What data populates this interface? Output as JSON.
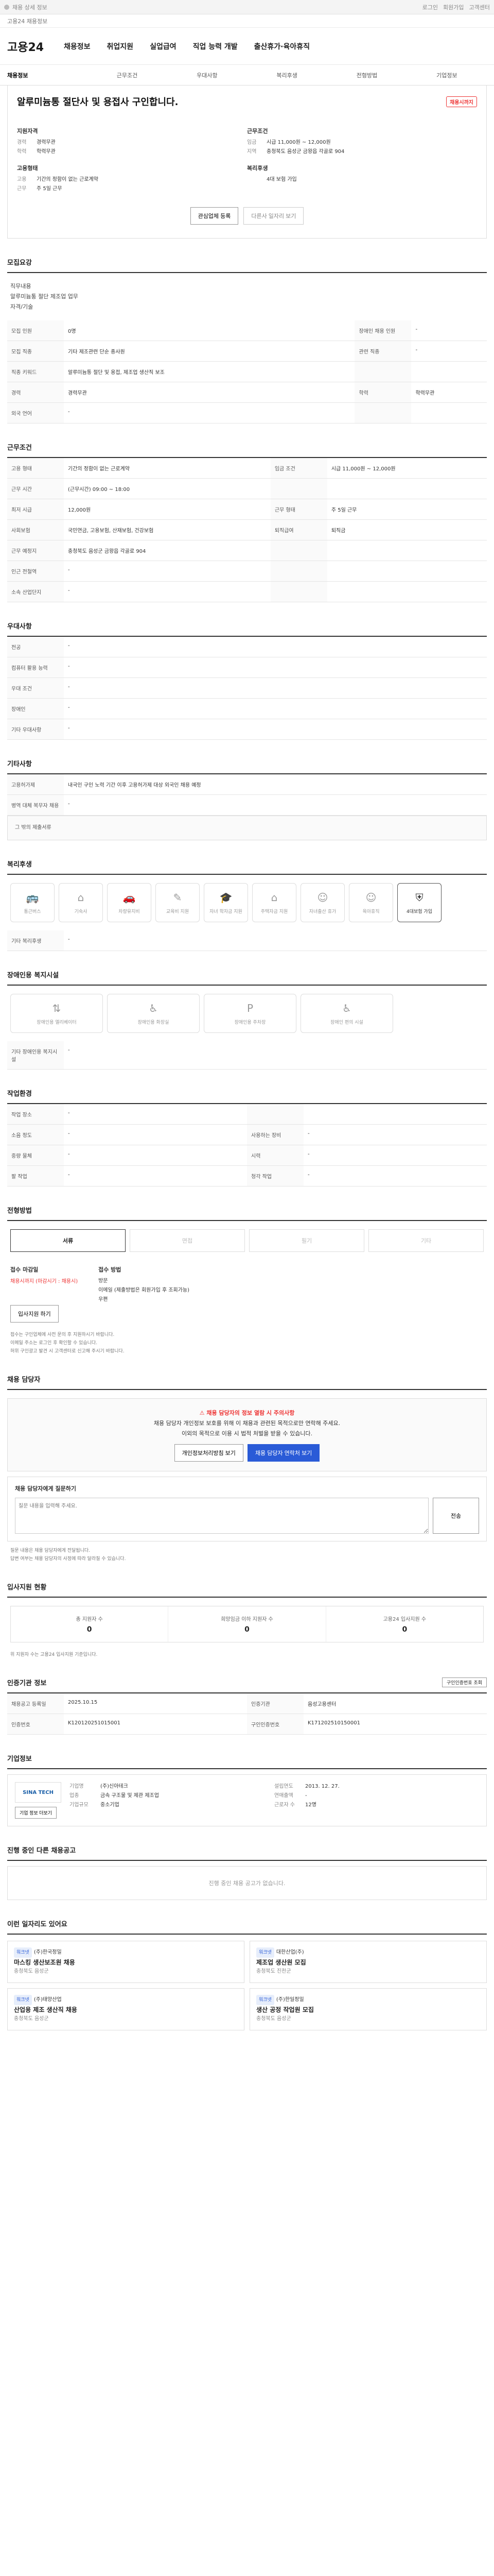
{
  "browser": {
    "bar_text": "채용 상세 정보",
    "right_items": [
      "로그인",
      "회원가입",
      "고객센터"
    ]
  },
  "infobar": {
    "text": "고용24 채용정보"
  },
  "nav": {
    "logo": "고용24",
    "menus": [
      "채용정보",
      "취업지원",
      "실업급여",
      "직업 능력 개발",
      "출산휴가·육아휴직"
    ]
  },
  "tabs": [
    "채용정보",
    "근무조건",
    "우대사항",
    "복리후생",
    "전형방법",
    "기업정보"
  ],
  "job": {
    "title": "알루미늄통 절단사 및 용접사 구인합니다.",
    "tag": "채용시까지",
    "qual_h": "지원자격",
    "qual": [
      {
        "k": "경력",
        "v": "경력무관"
      },
      {
        "k": "학력",
        "v": "학력무관"
      }
    ],
    "cond_h": "근무조건",
    "cond": [
      {
        "k": "임금",
        "v": "시급 11,000원 ~ 12,000원"
      },
      {
        "k": "지역",
        "v": "충청북도 음성군 금왕읍 각골로 904"
      }
    ],
    "emp_h": "고용형태",
    "emp": [
      {
        "k": "고용",
        "v": "기간의 정함이 없는 근로계약"
      },
      {
        "k": "근무",
        "v": "주 5일 근무"
      }
    ],
    "benefit_h": "복리후생",
    "benefit": [
      {
        "k": "",
        "v": "4대 보험 가입"
      }
    ],
    "btn_apply": "관심업체 등록",
    "btn_other": "다른사 일자리 보기"
  },
  "sections": {
    "job_content": "모집요강",
    "job_content_text": [
      "직무내용",
      "알루미늄통 절단 제조업 업무",
      "자격/기술"
    ],
    "recruit_rows": [
      {
        "k": "모집 인원",
        "v": "0명",
        "k2": "장애인 채용 인원",
        "v2": "-"
      },
      {
        "k": "모집 직종",
        "v": "기타 제조관련 단순 종사원",
        "k2": "관련 직종",
        "v2": "-"
      },
      {
        "k": "직종 키워드",
        "v": "알루미늄통 절단 및 용접, 제조업 생산직 보조",
        "k2": "",
        "v2": ""
      },
      {
        "k": "경력",
        "v": "경력무관",
        "k2": "학력",
        "v2": "학력무관"
      },
      {
        "k": "외국 언어",
        "v": "-",
        "k2": "",
        "v2": ""
      }
    ],
    "work_cond": "근무조건",
    "work_rows": [
      {
        "k": "고용 형태",
        "v": "기간의 정함이 없는 근로계약",
        "k2": "임금 조건",
        "v2": "시급 11,000원 ~ 12,000원"
      },
      {
        "k": "근무 시간",
        "v": "(근무시간) 09:00 ~ 18:00",
        "k2": "",
        "v2": ""
      },
      {
        "k": "최저 시급",
        "v": "12,000원",
        "k2": "근무 형태",
        "v2": "주 5일 근무"
      },
      {
        "k": "사회보험",
        "v": "국민연금, 고용보험, 산재보험, 건강보험",
        "k2": "퇴직급여",
        "v2": "퇴직금"
      },
      {
        "k": "근무 예정지",
        "v": "충청북도 음성군 금왕읍 각골로 904",
        "k2": "",
        "v2": ""
      },
      {
        "k": "인근 전철역",
        "v": "-",
        "k2": "",
        "v2": ""
      },
      {
        "k": "소속 산업단지",
        "v": "-",
        "k2": "",
        "v2": ""
      }
    ],
    "pref": "우대사항",
    "pref_rows": [
      {
        "k": "전공",
        "v": "-"
      },
      {
        "k": "컴퓨터 활용 능력",
        "v": "-"
      },
      {
        "k": "우대 조건",
        "v": "-"
      },
      {
        "k": "장애인",
        "v": "-"
      },
      {
        "k": "기타 우대사항",
        "v": "-"
      }
    ],
    "extra": "기타사항",
    "extra_rows": [
      {
        "k": "고용허가제",
        "v": "내국인 구인 노력 기간 이후 고용허가제 대상 외국인 채용 예정"
      },
      {
        "k": "병역 대체 복무자 채용",
        "v": "-"
      }
    ],
    "extra_note": "그 밖의 제출서류",
    "benefits_t": "복리후생",
    "benefit_items": [
      "통근버스",
      "기숙사",
      "차량유지비",
      "교육비 지원",
      "자녀 학자금 지원",
      "주택자금 지원",
      "자녀출산 휴가",
      "육아휴직",
      "4대보험 가입"
    ],
    "benefit_extra_label": "기타 복리후생",
    "disabled_t": "장애인용 복지시설",
    "disabled_items": [
      "장애인용 엘리베이터",
      "장애인용 화장실",
      "장애인용 주차장",
      "장애인 편의 시설"
    ],
    "disabled_extra_label": "기타 장애인용 복지시설",
    "place_t": "작업환경",
    "place_rows": [
      {
        "k": "작업 장소",
        "v": "-",
        "k2": "",
        "v2": ""
      },
      {
        "k": "소음 정도",
        "v": "-",
        "k2": "사용하는 장비",
        "v2": "-"
      },
      {
        "k": "중량 물체",
        "v": "-",
        "k2": "시력",
        "v2": "-"
      },
      {
        "k": "팔 작업",
        "v": "-",
        "k2": "청각 작업",
        "v2": "-"
      }
    ],
    "process_t": "전형방법",
    "process_steps": [
      "서류",
      "면접",
      "필기",
      "기타"
    ],
    "submit_h": "접수 마감일",
    "submit_date": "채용시까지 (마감시기 : 채용시)",
    "method_h": "접수 방법",
    "method_items": [
      "방문",
      "이메일 (제출방법은 회원가입 후 조회가능)",
      "우편"
    ],
    "apply_btn": "입사지원 하기",
    "process_notes": [
      "접수는 구인업체에 사전 문의 후 지원하시기 바랍니다.",
      "이메일 주소는 로그인 후 확인할 수 있습니다.",
      "허위 구인광고 발견 시 고객센터로 신고해 주시기 바랍니다."
    ],
    "contact_t": "채용 담당자",
    "contact_warn": "채용 담당자의 정보 열람 시 주의사항",
    "contact_text": [
      "채용 담당자 개인정보 보호를 위해 이 채용과 관련된 목적으로만 연락해 주세요.",
      "이외의 목적으로 이용 시 법적 처벌을 받을 수 있습니다."
    ],
    "contact_btn1": "개인정보처리방침 보기",
    "contact_btn2": "채용 담당자 연락처 보기",
    "qna_h": "채용 담당자에게 질문하기",
    "qna_placeholder": "질문 내용을 입력해 주세요.",
    "qna_btn": "전송",
    "qna_notes": [
      "질문 내용은 채용 담당자에게 전달됩니다.",
      "답변 여부는 채용 담당자의 사정에 따라 달라질 수 있습니다."
    ],
    "status_t": "입사지원 현황",
    "stats": [
      {
        "k": "총 지원자 수",
        "v": "0"
      },
      {
        "k": "희망임금 이하 지원자 수",
        "v": "0"
      },
      {
        "k": "고용24 입사지원 수",
        "v": "0"
      }
    ],
    "stats_note": "위 지원자 수는 고용24 입사지원 기준입니다.",
    "manage_t": "인증기관 정보",
    "manage_btn": "구인인증번호 조회",
    "manage_rows": [
      {
        "k": "채용공고 등록일",
        "v": "2025.10.15",
        "k2": "인증기관",
        "v2": "음성고용센터"
      },
      {
        "k": "인증번호",
        "v": "K120120251015001",
        "k2": "구인인증번호",
        "v2": "K171202510150001"
      }
    ],
    "company_t": "기업정보",
    "company_logo": "SINA TECH",
    "company_rows": [
      {
        "k": "기업명",
        "v": "(주)신아테크",
        "k2": "설립연도",
        "v2": "2013. 12. 27."
      },
      {
        "k": "업종",
        "v": "금속 구조물 및 제관 제조업",
        "k2": "연매출액",
        "v2": "-"
      },
      {
        "k": "기업규모",
        "v": "중소기업",
        "k2": "근로자 수",
        "v2": "12명"
      }
    ],
    "company_btn": "기업 정보 더보기",
    "other_t": "진행 중인 다른 채용공고",
    "other_empty": "진행 중인 채용 공고가 없습니다.",
    "rec_t": "이런 일자리도 있어요",
    "recs": [
      {
        "pill": "워크넷",
        "co": "(주)한국정밀",
        "t": "마스킹 생산보조원 채용",
        "meta": "충청북도 음성군"
      },
      {
        "pill": "워크넷",
        "co": "대한산업(주)",
        "t": "제조업 생산원 모집",
        "meta": "충청북도 진천군"
      },
      {
        "pill": "워크넷",
        "co": "(주)태양산업",
        "t": "산업용 제조 생산직 채용",
        "meta": "충청북도 음성군"
      },
      {
        "pill": "워크넷",
        "co": "(주)한일정밀",
        "t": "생산 공정 작업원 모집",
        "meta": "충청북도 음성군"
      }
    ]
  }
}
